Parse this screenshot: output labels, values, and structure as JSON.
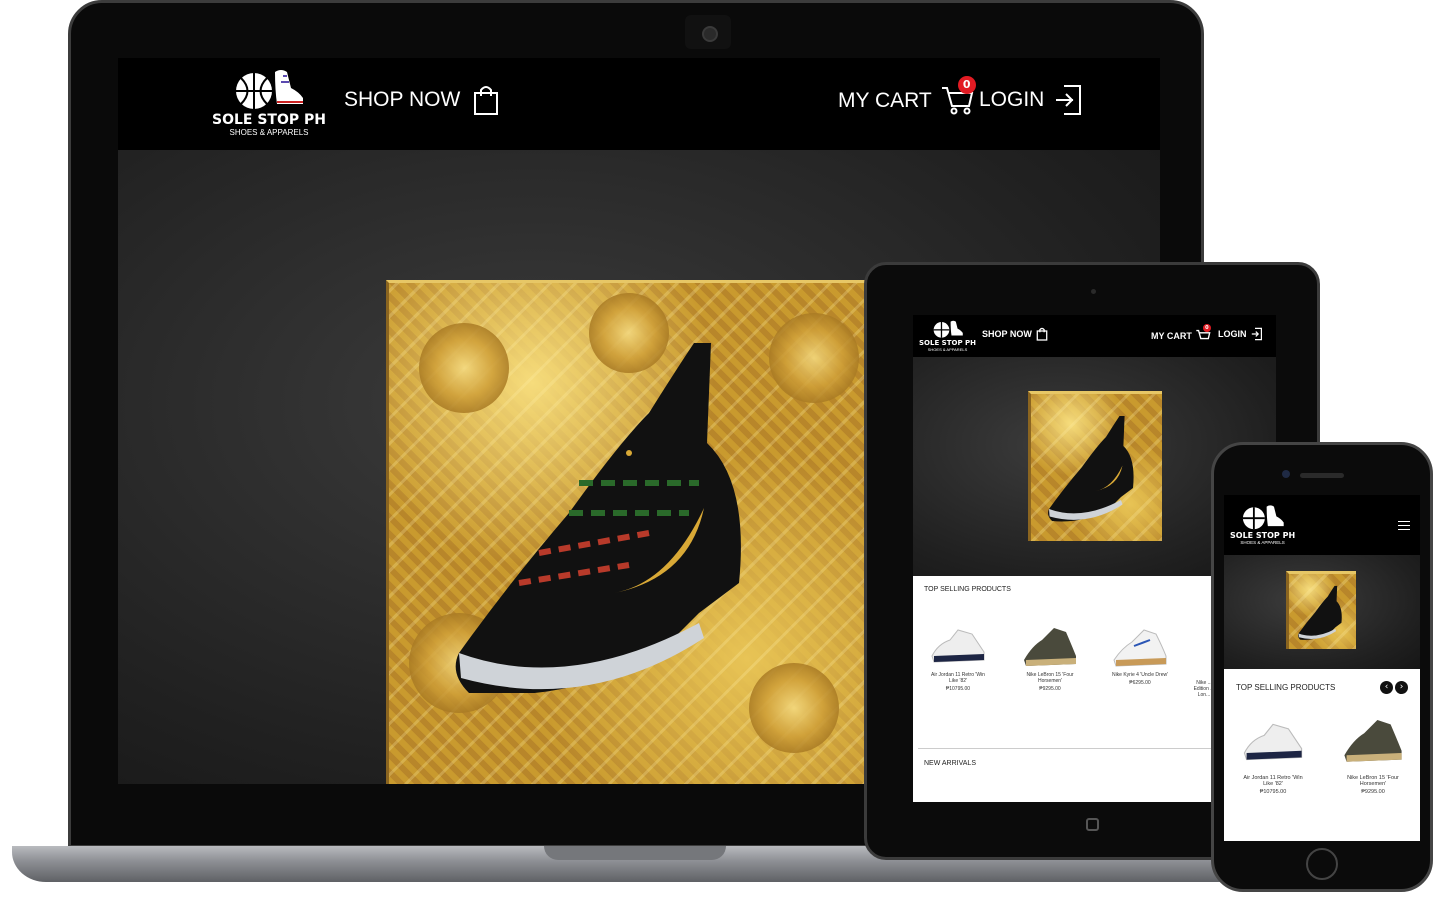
{
  "brand": {
    "name": "SOLE STOP PH",
    "tagline": "SHOES & APPARELS"
  },
  "nav": {
    "shop_label": "SHOP NOW",
    "cart_label": "MY CART",
    "cart_count": "0",
    "login_label": "LOGIN"
  },
  "icons": {
    "logo": "basketball-sneaker-logo-icon",
    "shop": "shopping-bag-icon",
    "cart": "shopping-cart-icon",
    "login": "login-arrow-icon",
    "menu": "hamburger-menu-icon",
    "prev": "chevron-left-icon",
    "next": "chevron-right-icon"
  },
  "sections": {
    "top_selling": "TOP SELLING PRODUCTS",
    "new_arrivals": "NEW ARRIVALS"
  },
  "products": [
    {
      "name": "Air Jordan 11 Retro 'Win Like '82'",
      "price": "₱10795.00"
    },
    {
      "name": "Nike LeBron 15 'Four Horsemen'",
      "price": "₱9295.00"
    },
    {
      "name": "Nike Kyrie 4 'Uncle Drew'",
      "price": "₱6295.00"
    },
    {
      "name": "Nike ... Edition ... Lon...",
      "price": ""
    }
  ],
  "colors": {
    "nav_bg": "#000000",
    "accent_gold": "#c59a35",
    "badge_red": "#e21b23",
    "content_bg": "#ffffff"
  }
}
